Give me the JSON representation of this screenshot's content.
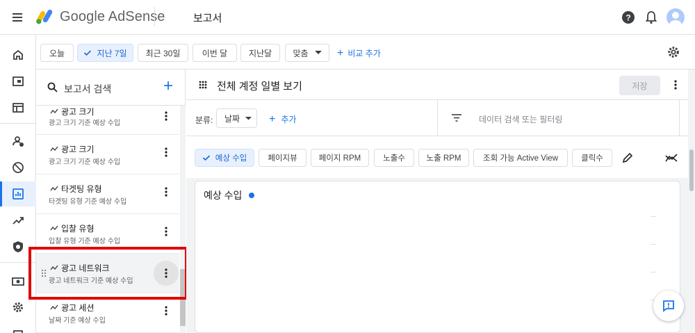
{
  "header": {
    "brand": "Google AdSense",
    "page_title": "보고서"
  },
  "filters": {
    "today": "오늘",
    "last7": "지난 7일",
    "last30": "최근 30일",
    "this_month": "이번 달",
    "last_month": "지난달",
    "custom": "맞춤",
    "compare": "비교 추가",
    "selected": "last7"
  },
  "report_list": {
    "search_label": "보고서 검색",
    "items": [
      {
        "title": "광고 크기",
        "subtitle": "광고 크기 기준 예상 수입"
      },
      {
        "title": "광고 크기",
        "subtitle": "광고 크기 기준 예상 수입"
      },
      {
        "title": "타겟팅 유형",
        "subtitle": "타겟팅 유형 기준 예상 수입"
      },
      {
        "title": "입찰 유형",
        "subtitle": "입찰 유형 기준 예상 수입"
      },
      {
        "title": "광고 네트워크",
        "subtitle": "광고 네트워크 기준 예상 수입"
      },
      {
        "title": "광고 세션",
        "subtitle": "날짜 기준 예상 수입"
      }
    ]
  },
  "main": {
    "report_title": "전체 계정 일별 보기",
    "save_label": "저장",
    "breakdown_label": "분류:",
    "breakdown_value": "날짜",
    "add_label": "추가",
    "filter_placeholder": "데이터 검색 또는 필터링",
    "metrics": [
      "예상 수입",
      "페이지뷰",
      "페이지 RPM",
      "노출수",
      "노출 RPM",
      "조회 가능 Active View",
      "클릭수"
    ],
    "selected_metric": "예상 수입",
    "chart_title": "예상 수입"
  },
  "colors": {
    "accent": "#1a73e8",
    "highlight": "#e00000"
  }
}
